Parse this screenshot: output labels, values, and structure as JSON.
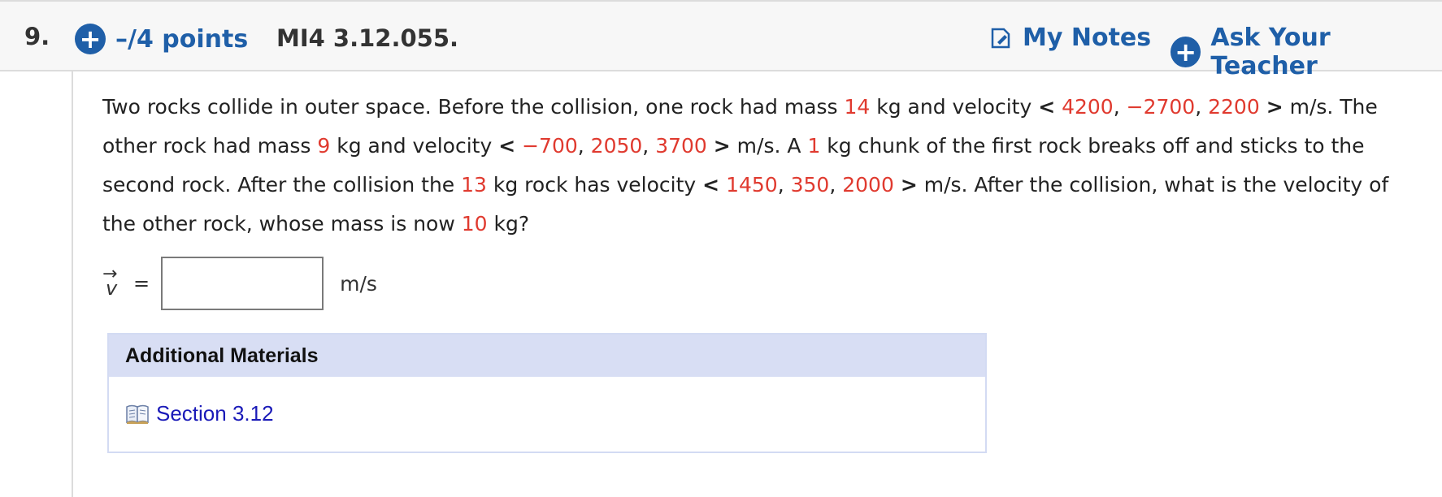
{
  "header": {
    "question_number": "9.",
    "points_label": "–/4 points",
    "question_id": "MI4 3.12.055.",
    "my_notes_label": "My Notes",
    "ask_teacher_label": "Ask Your Teacher",
    "plus_glyph": "+",
    "notes_icon": "notes-icon",
    "plus_icon": "plus-circle-icon"
  },
  "problem": {
    "t1": "Two rocks collide in outer space. Before the collision, one rock had mass ",
    "m1": "14",
    "t2": " kg and velocity ",
    "v1x": "4200",
    "v1y": "−2700",
    "v1z": "2200",
    "t3": " m/s. The other rock had mass ",
    "m2": "9",
    "t4": " kg and velocity ",
    "v2x": "−700",
    "v2y": "2050",
    "v2z": "3700",
    "t5": " m/s. A ",
    "chunk": "1",
    "t6": " kg chunk of the first rock breaks off and sticks to the second rock. After the collision the ",
    "m3": "13",
    "t7": " kg rock has velocity ",
    "v3x": "1450",
    "v3y": "350",
    "v3z": "2000",
    "t8": " m/s. After the collision, what is the velocity of the other rock, whose mass is now ",
    "m4": "10",
    "t9": " kg?",
    "lt": "<",
    "gt": ">",
    "comma": ", ",
    "value_color": "#e03a2f"
  },
  "answer": {
    "vector_letter": "v",
    "arrow": "→",
    "equals": "=",
    "value": "",
    "unit": "m/s"
  },
  "materials": {
    "heading": "Additional Materials",
    "link_label": "Section 3.12",
    "link_icon": "book-icon",
    "header_bg": "#d8def4",
    "link_color": "#1a1ab8"
  },
  "colors": {
    "accent": "#1f5fa8",
    "header_bg": "#f7f7f7"
  }
}
